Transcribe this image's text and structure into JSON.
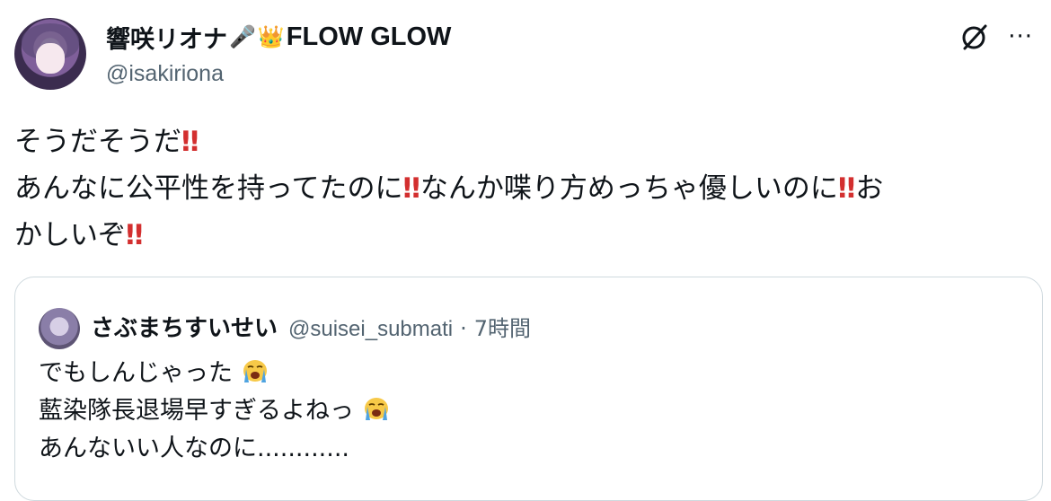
{
  "tweet": {
    "author": {
      "display_name": "響咲リオナ",
      "name_emojis": [
        "microphone",
        "crown"
      ],
      "brand": "FLOW GLOW",
      "handle": "@isakiriona"
    },
    "icons": [
      "grok-icon",
      "more-icon"
    ],
    "more_label": "···",
    "body": {
      "line1": {
        "text": "そうだそうだ",
        "bang": "‼"
      },
      "line2": {
        "seg1": "あんなに公平性を持ってたのに",
        "seg2": "なんか喋り方めっちゃ優しいのに",
        "seg3": "お",
        "bang": "‼"
      },
      "line3": {
        "text": "かしいぞ",
        "bang": "‼"
      }
    }
  },
  "quote": {
    "author": {
      "display_name": "さぶまちすいせい",
      "handle": "@suisei_submati",
      "separator": "·",
      "time": "7時間"
    },
    "body": {
      "line1": "でもしんじゃった",
      "line2": "藍染隊長退場早すぎるよねっ",
      "line3": "あんないい人なのに............"
    },
    "emoji": "loudly-crying-face"
  },
  "colors": {
    "text": "#0f1419",
    "secondary": "#536471",
    "border": "#cfd9de",
    "bang_red": "#d32f2f"
  }
}
